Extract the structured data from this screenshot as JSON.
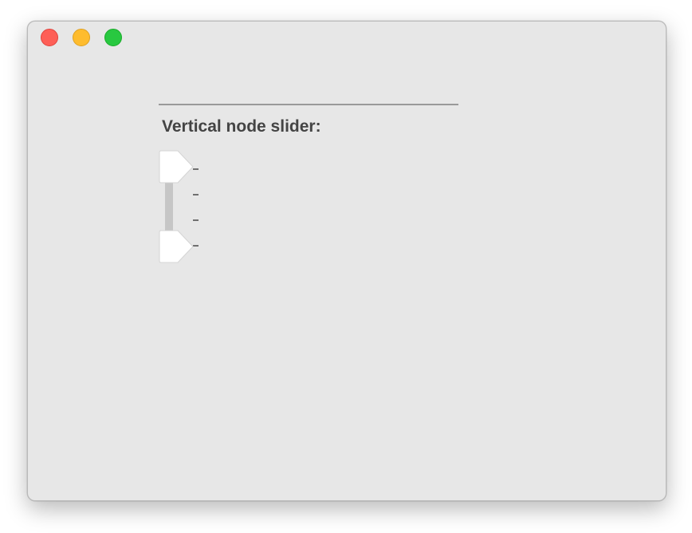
{
  "window": {
    "controls": [
      {
        "name": "close-button",
        "color": "#fe5f57"
      },
      {
        "name": "minimize-button",
        "color": "#febc2e"
      },
      {
        "name": "zoom-button",
        "color": "#28c840"
      }
    ]
  },
  "slider": {
    "label": "Vertical node slider:",
    "orientation": "vertical",
    "tick_count": 4,
    "thumbs": [
      {
        "name": "upper",
        "value": 1.0
      },
      {
        "name": "lower",
        "value": 0.0
      }
    ],
    "track_color": "#c6c6c6",
    "thumb_color": "#ffffff"
  }
}
